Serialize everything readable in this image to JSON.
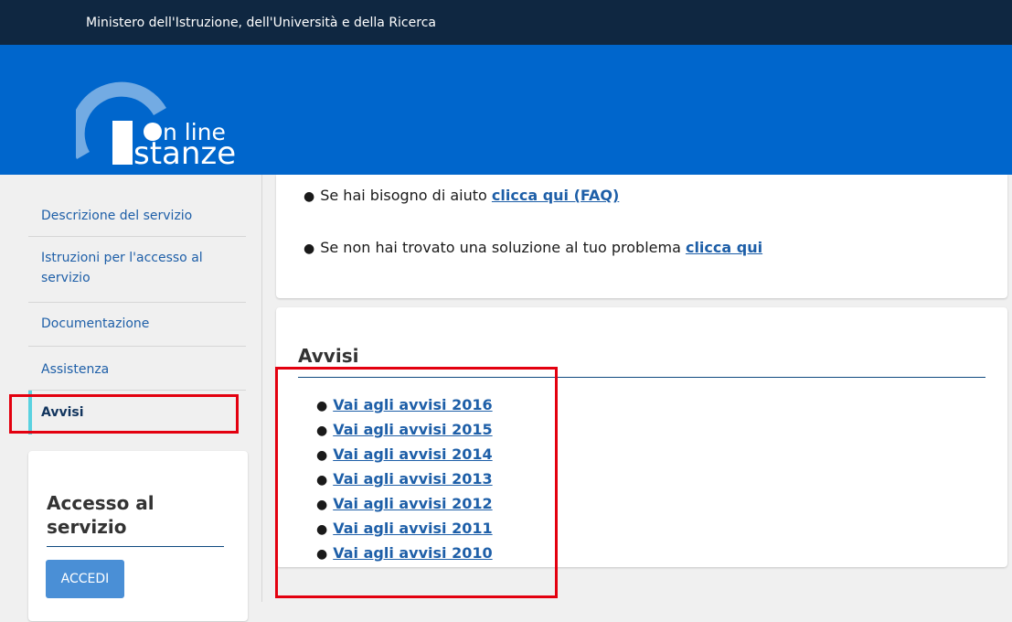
{
  "topbar": {
    "ministry": "Ministero dell'Istruzione, dell'Università e della Ricerca"
  },
  "logo": {
    "line1": "n line",
    "line2": "stanze"
  },
  "sidebar": {
    "items": [
      {
        "label": "Descrizione del servizio"
      },
      {
        "label_line1": "Istruzioni per l'accesso al",
        "label_line2": "servizio"
      },
      {
        "label": "Documentazione"
      },
      {
        "label": "Assistenza"
      },
      {
        "label": "Avvisi",
        "active": true
      }
    ]
  },
  "access": {
    "title_line1": "Accesso al",
    "title_line2": "servizio",
    "button": "ACCEDI"
  },
  "help": {
    "line1_text": "Se hai bisogno di aiuto ",
    "line1_link": "clicca qui (FAQ)",
    "line2_text": "Se non hai trovato una soluzione al tuo problema ",
    "line2_link": "clicca qui"
  },
  "avvisi": {
    "title": "Avvisi",
    "links": [
      "Vai agli avvisi 2016",
      "Vai agli avvisi 2015",
      "Vai agli avvisi 2014",
      "Vai agli avvisi 2013",
      "Vai agli avvisi 2012",
      "Vai agli avvisi 2011",
      "Vai agli avvisi 2010"
    ]
  },
  "colors": {
    "topbar": "#0f2741",
    "header": "#0066cc",
    "link": "#1e5fa8",
    "active_marker": "#5ad2e0",
    "highlight": "#e3000f",
    "button": "#4a8fd6"
  }
}
